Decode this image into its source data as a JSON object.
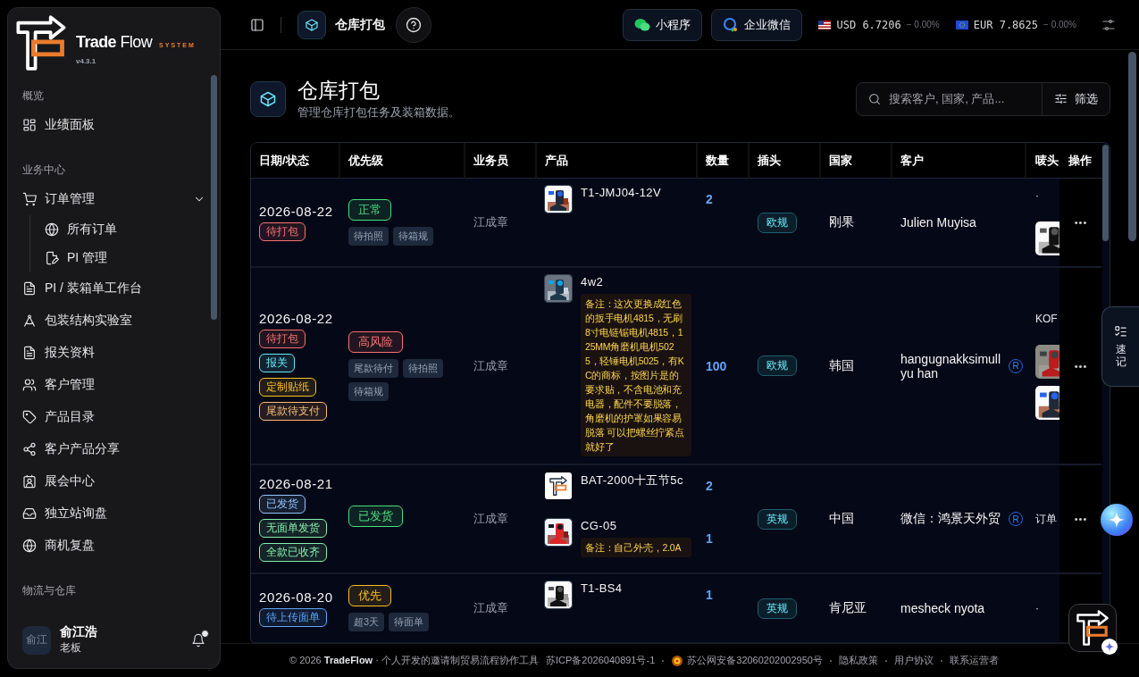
{
  "sidebar": {
    "brand": "**Trade** Flow",
    "brand_tag": "SYSTEM",
    "version": "v4.3.1",
    "sections": [
      {
        "title": "概览",
        "items": [
          {
            "label": "业绩面板"
          }
        ]
      },
      {
        "title": "业务中心",
        "items": [
          {
            "label": "订单管理",
            "expanded": true,
            "children": [
              {
                "label": "所有订单"
              },
              {
                "label": "PI 管理"
              }
            ]
          },
          {
            "label": "PI / 装箱单工作台"
          },
          {
            "label": "包装结构实验室"
          },
          {
            "label": "报关资料"
          },
          {
            "label": "客户管理"
          },
          {
            "label": "产品目录"
          },
          {
            "label": "客户产品分享"
          },
          {
            "label": "展会中心"
          },
          {
            "label": "独立站询盘"
          },
          {
            "label": "商机复盘"
          }
        ]
      },
      {
        "title": "物流与仓库"
      }
    ],
    "user": {
      "avatar": "俞江",
      "name": "俞江浩",
      "role": "老板",
      "unread": true
    }
  },
  "topbar": {
    "page": "仓库打包",
    "buttons": [
      {
        "label": "小程序"
      },
      {
        "label": "企业微信"
      }
    ],
    "rates": [
      {
        "currency": "USD",
        "rate": "6.7206",
        "change": "− 0.00%"
      },
      {
        "currency": "EUR",
        "rate": "7.8625",
        "change": "− 0.00%"
      }
    ]
  },
  "header": {
    "title": "仓库打包",
    "subtitle": "管理仓库打包任务及装箱数据。",
    "search_placeholder": "搜索客户, 国家, 产品...",
    "filter": "筛选"
  },
  "table": {
    "columns": [
      "日期/状态",
      "优先级",
      "业务员",
      "产品",
      "数量",
      "插头",
      "国家",
      "客户",
      "唛头",
      "操作"
    ],
    "rows": [
      {
        "date": "2026-08-22",
        "tags": [
          {
            "label": "待打包",
            "color": "#f87171"
          }
        ],
        "priority": {
          "label": "正常",
          "color": "#4ade80"
        },
        "flags": [
          "待拍照",
          "待箱规"
        ],
        "sales": "江成章",
        "products": [
          {
            "code": "T1-JMJ04-12V",
            "qty": "2"
          }
        ],
        "plug": "欧规",
        "country": "刚果",
        "customer": "Julien Muyisa",
        "mark": {
          "text": "·"
        },
        "action": "•••"
      },
      {
        "date": "2026-08-22",
        "tags": [
          {
            "label": "待打包",
            "color": "#f87171"
          },
          {
            "label": "报关",
            "color": "#67e8f9"
          },
          {
            "label": "定制贴纸",
            "color": "#fbbf24"
          },
          {
            "label": "尾款待支付",
            "color": "#fdba74"
          }
        ],
        "priority": {
          "label": "高风险",
          "color": "#f87171"
        },
        "flags": [
          "尾款待付",
          "待拍照",
          "待箱规"
        ],
        "sales": "江成章",
        "products": [
          {
            "code": "4w2",
            "qty": "100",
            "note": "备注：这次更换成红色的扳手电机4815，无刷8寸电链锯电机4815，125MM角磨机电机5025，轻锤电机5025，有KC的商标，按图片是的要求贴，不含电池和充电器，配件不要脱落，角磨机的护罩如果容易脱落 可以把螺丝拧紧点就好了"
          }
        ],
        "plug": "欧规",
        "country": "韩国",
        "customer": "hangugnakksimullyu han",
        "customer_badge": "R",
        "mark": {
          "text": "KOF"
        },
        "action": "•••"
      },
      {
        "date": "2026-08-21",
        "tags": [
          {
            "label": "已发货",
            "color": "#93c5fd"
          },
          {
            "label": "无面单发货",
            "color": "#86efac"
          },
          {
            "label": "全款已收齐",
            "color": "#86efac"
          }
        ],
        "priority": {
          "label": "已发货",
          "color": "#4ade80"
        },
        "sales": "江成章",
        "products": [
          {
            "code": "BAT-2000十五节5c",
            "qty": "2"
          },
          {
            "code": "CG-05",
            "qty": "1",
            "note": "备注：自己外壳，2.0A"
          }
        ],
        "plug": "英规",
        "country": "中国",
        "customer": "微信：鸿景天外贸",
        "customer_badge": "R",
        "mark": {
          "text": "订单"
        },
        "action": "•••"
      },
      {
        "date": "2026-08-20",
        "tags": [
          {
            "label": "待上传面单",
            "color": "#60a5fa"
          }
        ],
        "priority": {
          "label": "优先",
          "color": "#fbbf24"
        },
        "flags": [
          "超3天",
          "待面单"
        ],
        "sales": "江成章",
        "products": [
          {
            "code": "T1-BS4",
            "qty": "1"
          }
        ],
        "plug": "英规",
        "country": "肯尼亚",
        "customer": "mesheck nyota",
        "mark": {
          "text": "·"
        }
      }
    ]
  },
  "side_tab": {
    "label": "速记"
  },
  "footer": {
    "copyright": "© 2026 **TradeFlow** · 个人开发的邀请制贸易流程协作工具",
    "icp": "苏ICP备2026040891号-1",
    "police": "苏公网安备32060202002950号",
    "links": [
      "隐私政策",
      "用户协议",
      "联系运营者"
    ]
  }
}
